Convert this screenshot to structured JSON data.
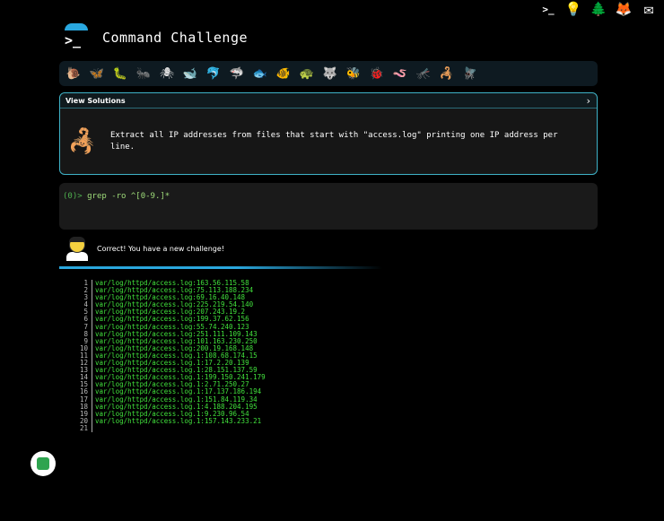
{
  "header": {
    "title": "Command Challenge",
    "logo_glyph": ">_"
  },
  "top_icons": [
    {
      "name": "terminal-icon",
      "glyph": ">_"
    },
    {
      "name": "bulb-icon",
      "glyph": "💡"
    },
    {
      "name": "tree-icon",
      "glyph": "🌲"
    },
    {
      "name": "gitlab-icon",
      "glyph": "🦊"
    },
    {
      "name": "mail-icon",
      "glyph": "✉"
    }
  ],
  "critters": [
    {
      "name": "snail-icon",
      "glyph": "🐌"
    },
    {
      "name": "butterfly-icon",
      "glyph": "🦋"
    },
    {
      "name": "caterpillar-icon",
      "glyph": "🐛"
    },
    {
      "name": "ant-icon",
      "glyph": "🐜"
    },
    {
      "name": "spider-icon",
      "glyph": "🕷"
    },
    {
      "name": "whale-icon",
      "glyph": "🐋"
    },
    {
      "name": "dolphin-icon",
      "glyph": "🐬"
    },
    {
      "name": "shark-icon",
      "glyph": "🦈"
    },
    {
      "name": "fish-icon",
      "glyph": "🐟"
    },
    {
      "name": "tropical-fish-icon",
      "glyph": "🐠"
    },
    {
      "name": "turtle-icon",
      "glyph": "🐢"
    },
    {
      "name": "wolf-icon",
      "glyph": "🐺"
    },
    {
      "name": "bee-icon",
      "glyph": "🐝"
    },
    {
      "name": "ladybug-icon",
      "glyph": "🐞"
    },
    {
      "name": "worm-icon",
      "glyph": "🪱"
    },
    {
      "name": "mosquito-icon",
      "glyph": "🦟"
    },
    {
      "name": "scorpion-icon",
      "glyph": "🦂"
    },
    {
      "name": "fly-icon",
      "glyph": "🪰"
    }
  ],
  "panel": {
    "label": "View Solutions",
    "chevron": "›",
    "task": "Extract all IP addresses from files that start with \"access.log\" printing one IP address per line."
  },
  "terminal": {
    "prompt": "(0)>",
    "command": "grep -ro ^[0-9.]*"
  },
  "feedback": {
    "message": "Correct! You have a new challenge!"
  },
  "output": [
    {
      "n": "1",
      "t": "var/log/httpd/access.log:163.56.115.58"
    },
    {
      "n": "2",
      "t": "var/log/httpd/access.log:75.113.188.234"
    },
    {
      "n": "3",
      "t": "var/log/httpd/access.log:69.16.40.148"
    },
    {
      "n": "4",
      "t": "var/log/httpd/access.log:225.219.54.140"
    },
    {
      "n": "5",
      "t": "var/log/httpd/access.log:207.243.19.2"
    },
    {
      "n": "6",
      "t": "var/log/httpd/access.log:199.37.62.156"
    },
    {
      "n": "7",
      "t": "var/log/httpd/access.log:55.74.240.123"
    },
    {
      "n": "8",
      "t": "var/log/httpd/access.log:251.111.109.143"
    },
    {
      "n": "9",
      "t": "var/log/httpd/access.log:101.163.230.250"
    },
    {
      "n": "10",
      "t": "var/log/httpd/access.log:200.19.168.148"
    },
    {
      "n": "11",
      "t": "var/log/httpd/access.log.1:108.68.174.15"
    },
    {
      "n": "12",
      "t": "var/log/httpd/access.log.1:17.2.20.139"
    },
    {
      "n": "13",
      "t": "var/log/httpd/access.log.1:28.151.137.59"
    },
    {
      "n": "14",
      "t": "var/log/httpd/access.log.1:199.150.241.179"
    },
    {
      "n": "15",
      "t": "var/log/httpd/access.log.1:2.71.250.27"
    },
    {
      "n": "16",
      "t": "var/log/httpd/access.log.1:17.137.186.194"
    },
    {
      "n": "17",
      "t": "var/log/httpd/access.log.1:151.84.119.34"
    },
    {
      "n": "18",
      "t": "var/log/httpd/access.log.1:4.188.204.195"
    },
    {
      "n": "19",
      "t": "var/log/httpd/access.log.1:9.230.96.54"
    },
    {
      "n": "20",
      "t": "var/log/httpd/access.log.1:157.143.233.21"
    },
    {
      "n": "21",
      "t": ""
    }
  ]
}
